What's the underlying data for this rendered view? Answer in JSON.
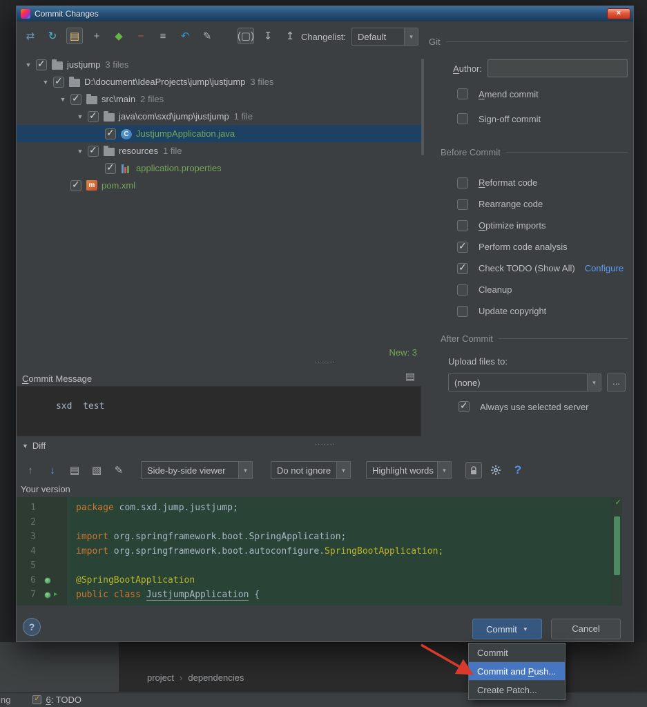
{
  "colors": {
    "selection_blue": "#4676c1",
    "new_file_green": "#73a757",
    "link_blue": "#589df6",
    "added_line_bg": "#294436",
    "commit_button_bg": "#365880",
    "annotation_red": "#d93a2b"
  },
  "window": {
    "title": "Commit Changes"
  },
  "main_toolbar": {
    "icons": [
      {
        "name": "show-diff-icon",
        "glyph": "⇄",
        "color": "#6897bb"
      },
      {
        "name": "refresh-icon",
        "glyph": "↻",
        "color": "#4dbbd6"
      },
      {
        "name": "move-to-changelist-icon",
        "glyph": "▤",
        "color": "#e8c575",
        "boxed": true
      },
      {
        "name": "add-icon",
        "glyph": "+",
        "color": "#afb1b3"
      },
      {
        "name": "new-changelist-icon",
        "glyph": "◆",
        "color": "#62b543"
      },
      {
        "name": "remove-icon",
        "glyph": "−",
        "color": "#c75450"
      },
      {
        "name": "group-icon",
        "glyph": "≡",
        "color": "#afb1b3"
      },
      {
        "name": "rollback-icon",
        "glyph": "↶",
        "color": "#3592c4"
      },
      {
        "name": "edit-source-icon",
        "glyph": "✎",
        "color": "#afb1b3"
      },
      {
        "name": "directory-grouping-icon",
        "glyph": "(▢)",
        "color": "#afb1b3",
        "boxed": true,
        "gap": true
      },
      {
        "name": "expand-all-icon",
        "glyph": "↧",
        "color": "#afb1b3"
      },
      {
        "name": "collapse-all-icon",
        "glyph": "↥",
        "color": "#afb1b3"
      }
    ],
    "changelist_label": "Changelist:",
    "changelist_value": "Default"
  },
  "tree": {
    "rows": [
      {
        "level": 0,
        "expander": true,
        "icon": "folder",
        "label": "justjump",
        "suffix": "3 files"
      },
      {
        "level": 1,
        "expander": true,
        "icon": "folder",
        "label": "D:\\document\\IdeaProjects\\jump\\justjump",
        "suffix": "3 files"
      },
      {
        "level": 2,
        "expander": true,
        "icon": "folder",
        "label": "src\\main",
        "suffix": "2 files"
      },
      {
        "level": 3,
        "expander": true,
        "icon": "folder",
        "label": "java\\com\\sxd\\jump\\justjump",
        "suffix": "1 file"
      },
      {
        "level": 4,
        "expander": false,
        "icon": "class",
        "label": "JustjumpApplication.java",
        "suffix": "",
        "green": true,
        "selected": true
      },
      {
        "level": 3,
        "expander": true,
        "icon": "folder",
        "label": "resources",
        "suffix": "1 file"
      },
      {
        "level": 4,
        "expander": false,
        "icon": "properties",
        "label": "application.properties",
        "suffix": "",
        "green": true
      },
      {
        "level": 2,
        "expander": false,
        "icon": "maven",
        "label": "pom.xml",
        "suffix": "",
        "green": true
      }
    ],
    "new_count": "New: 3"
  },
  "right_panel": {
    "git_header": "Git",
    "author_label": "Author:",
    "author_mnemonic": "A",
    "author_value": "",
    "amend": {
      "label": "Amend commit",
      "checked": false,
      "mnemonic": "A"
    },
    "signoff": {
      "label": "Sign-off commit",
      "checked": false
    },
    "before_header": "Before Commit",
    "before_items": [
      {
        "label": "Reformat code",
        "checked": false,
        "mnemonic": "R"
      },
      {
        "label": "Rearrange code",
        "checked": false
      },
      {
        "label": "Optimize imports",
        "checked": false,
        "mnemonic": "O"
      },
      {
        "label": "Perform code analysis",
        "checked": true
      },
      {
        "label": "Check TODO (Show All)",
        "checked": true,
        "link": "Configure"
      },
      {
        "label": "Cleanup",
        "checked": false
      },
      {
        "label": "Update copyright",
        "checked": false
      }
    ],
    "after_header": "After Commit",
    "upload_label": "Upload files to:",
    "upload_value": "(none)",
    "more_button": "...",
    "always_server": {
      "label": "Always use selected server",
      "checked": true
    }
  },
  "commit_message": {
    "header": "Commit Message",
    "mnemonic": "C",
    "text": "sxd  test"
  },
  "diff": {
    "header": "Diff",
    "toolbar": {
      "icons_left": [
        {
          "name": "previous-difference-icon",
          "glyph": "↑",
          "color": "#8a8d8f"
        },
        {
          "name": "next-difference-icon",
          "glyph": "↓",
          "color": "#5c9ced"
        },
        {
          "name": "go-to-changed-file-icon",
          "glyph": "▤",
          "color": "#afb1b3"
        },
        {
          "name": "jump-to-source-icon",
          "glyph": "▧",
          "color": "#afb1b3"
        },
        {
          "name": "edit-source-icon",
          "glyph": "✎",
          "color": "#afb1b3"
        }
      ],
      "viewer_value": "Side-by-side viewer",
      "ignore_value": "Do not ignore",
      "highlight_value": "Highlight words",
      "icons_right": [
        {
          "name": "disable-editing-lock-icon",
          "svg": "lock",
          "boxed": true
        },
        {
          "name": "settings-gear-icon",
          "svg": "gear"
        },
        {
          "name": "help-icon",
          "glyph": "?",
          "color": "#5394ec",
          "big": true
        }
      ]
    },
    "version_label": "Your version",
    "code": {
      "lines": [
        {
          "num": "1",
          "segs": [
            [
              "kw",
              "package"
            ],
            [
              "pl",
              " com.sxd.jump.justjump;"
            ]
          ]
        },
        {
          "num": "2",
          "segs": []
        },
        {
          "num": "3",
          "segs": [
            [
              "kw",
              "import"
            ],
            [
              "pl",
              " org.springframework.boot.SpringApplication;"
            ]
          ]
        },
        {
          "num": "4",
          "segs": [
            [
              "kw",
              "import"
            ],
            [
              "pl",
              " org.springframework.boot.autoconfigure."
            ],
            [
              "ann",
              "SpringBootApplication;"
            ]
          ]
        },
        {
          "num": "5",
          "segs": []
        },
        {
          "num": "6",
          "segs": [
            [
              "ann",
              "@SpringBootApplication"
            ]
          ],
          "gutter": [
            "bean"
          ]
        },
        {
          "num": "7",
          "segs": [
            [
              "kw",
              "public class"
            ],
            [
              "pl",
              " "
            ],
            [
              "u",
              "JustjumpApplication"
            ],
            [
              "pl",
              " {"
            ]
          ],
          "gutter": [
            "bean",
            "run"
          ]
        }
      ]
    }
  },
  "footer": {
    "help_glyph": "?",
    "commit_label": "Commit",
    "cancel_label": "Cancel"
  },
  "popup": {
    "items": [
      {
        "label": "Commit",
        "selected": false
      },
      {
        "label": "Commit and Push...",
        "selected": true,
        "mnemonic": "P"
      },
      {
        "label": "Create Patch...",
        "selected": false
      }
    ]
  },
  "background": {
    "breadcrumbs": [
      "project",
      "dependencies"
    ],
    "statusbar_left": "ng",
    "todo_button": {
      "label": "6: TODO",
      "mnemonic": "6"
    }
  }
}
